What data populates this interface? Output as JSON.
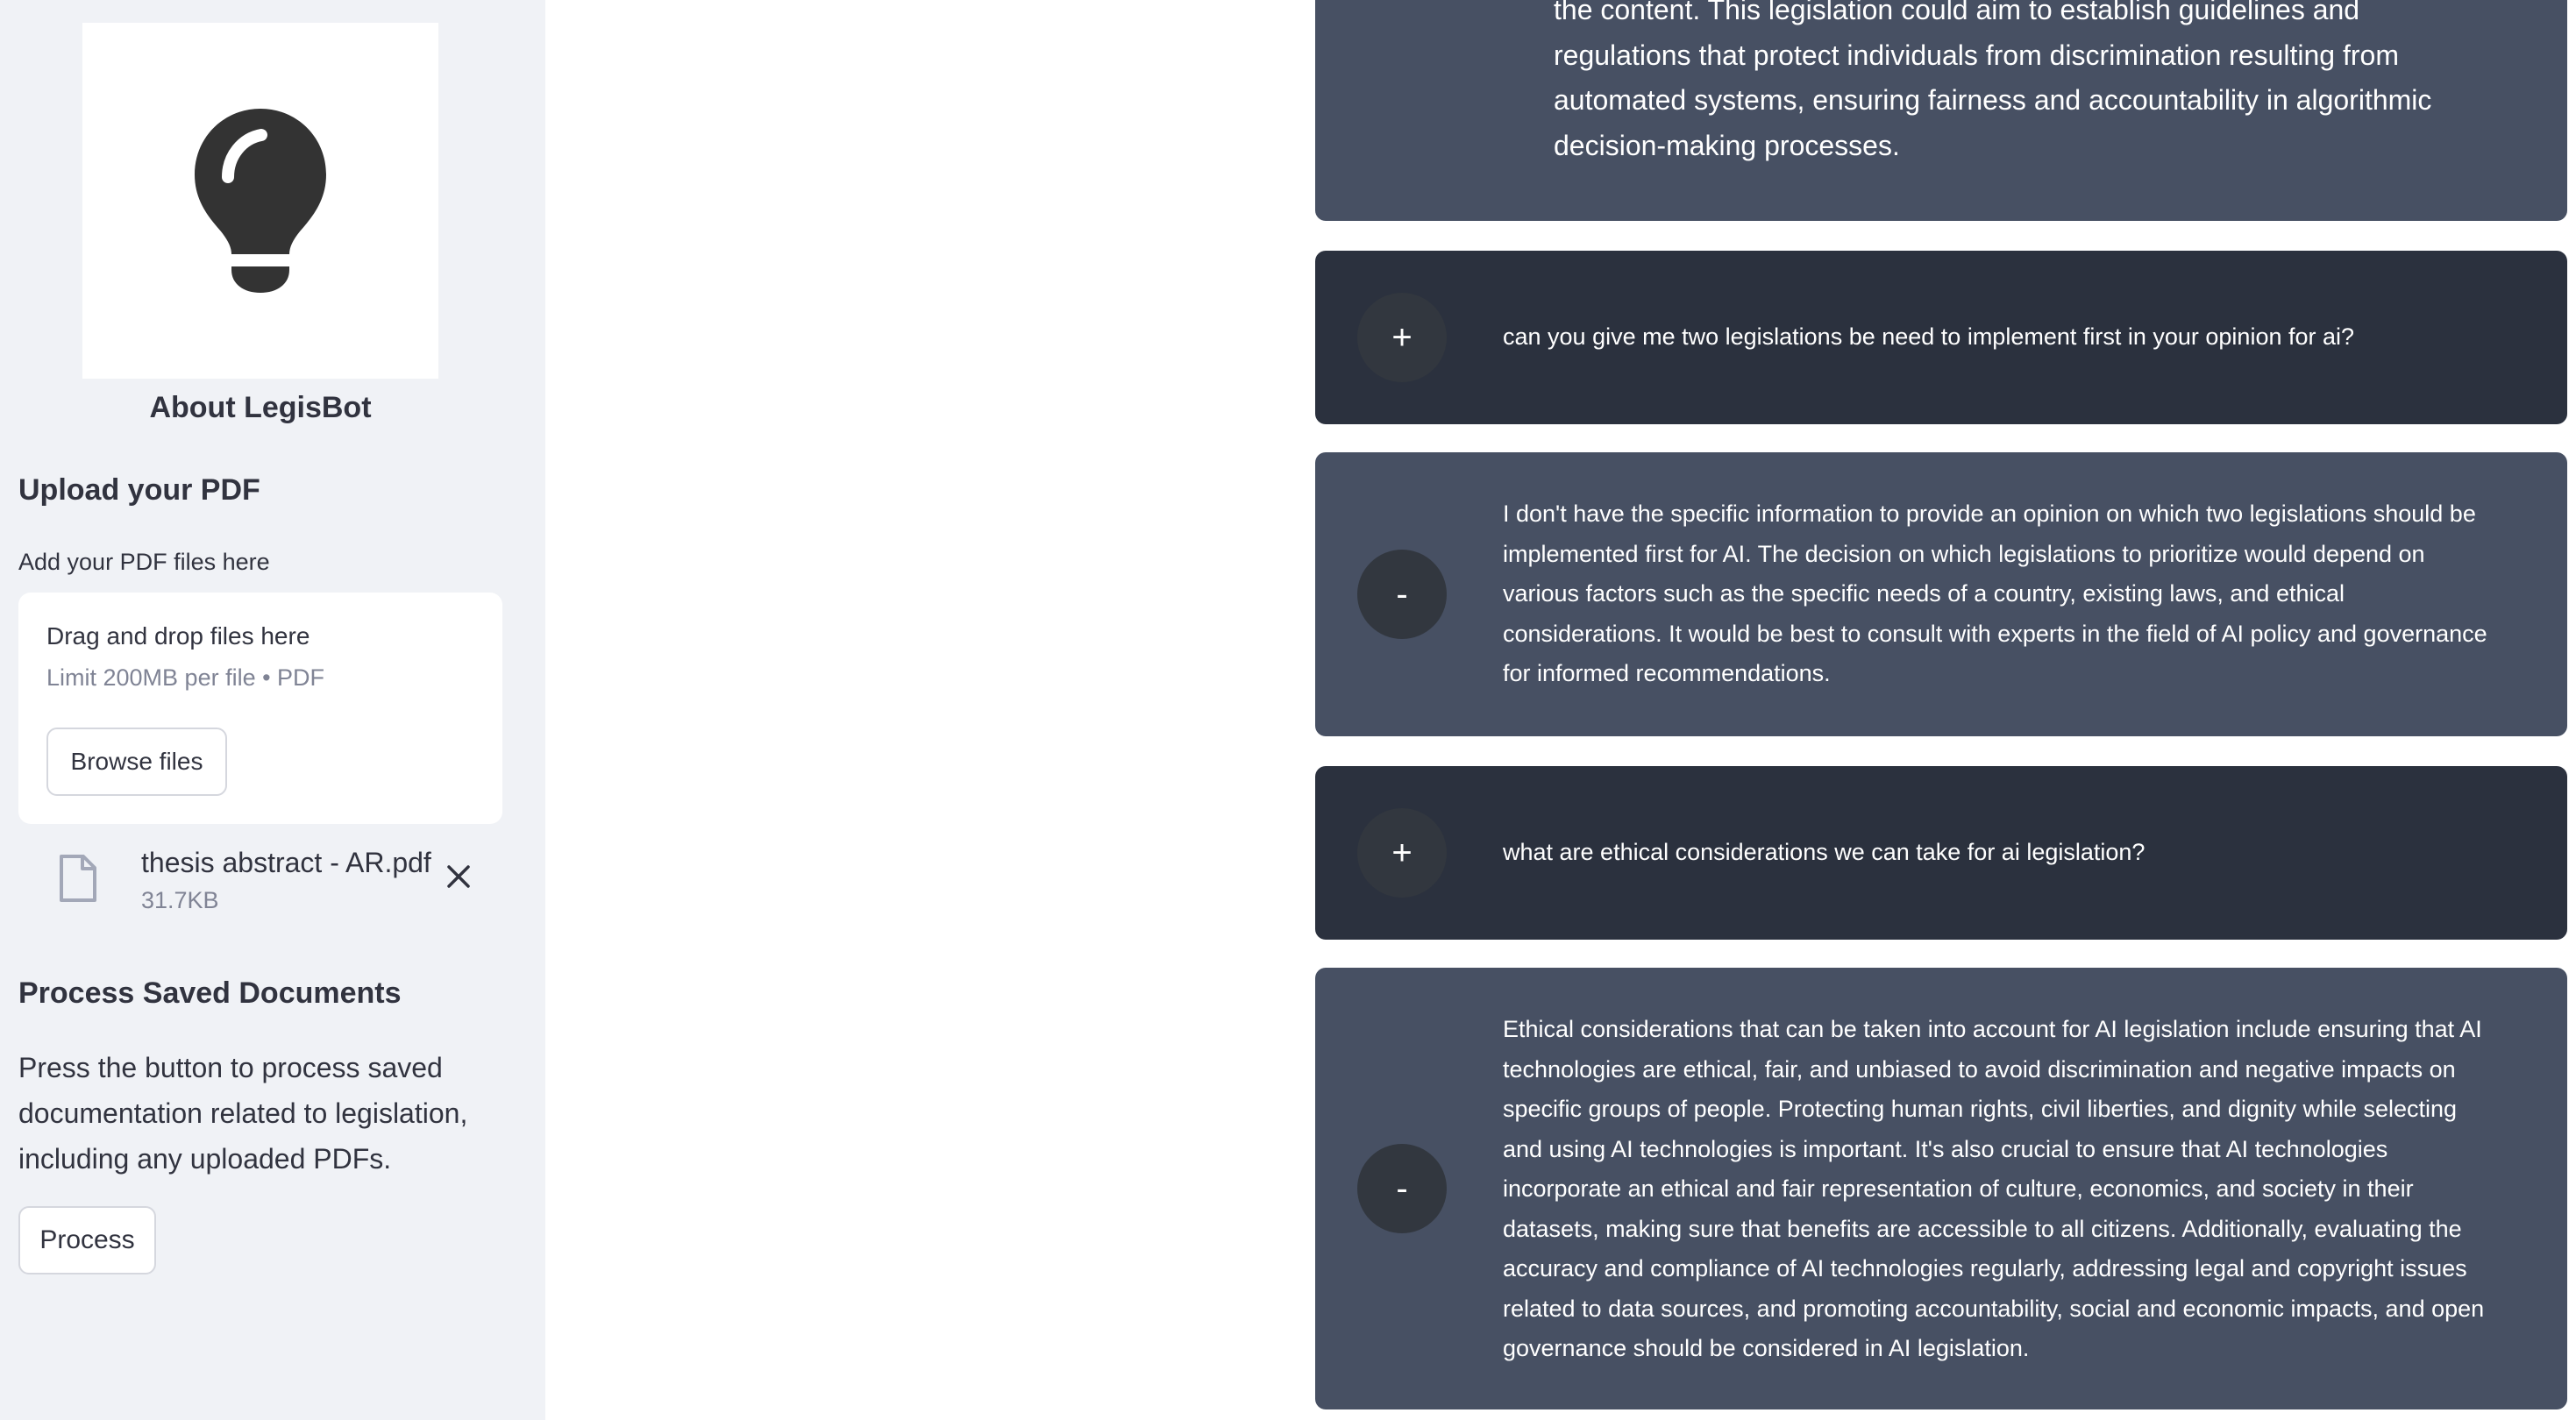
{
  "sidebar": {
    "logo_icon": "lightbulb-icon",
    "about_title": "About LegisBot",
    "upload_heading": "Upload your PDF",
    "upload_label": "Add your PDF files here",
    "dropzone": {
      "title": "Drag and drop files here",
      "limit": "Limit 200MB per file • PDF",
      "browse_label": "Browse files"
    },
    "uploaded_file": {
      "name": "thesis abstract - AR.pdf",
      "size": "31.7KB"
    },
    "process_heading": "Process Saved Documents",
    "process_description": "Press the button to process saved documentation related to legislation, including any uploaded PDFs.",
    "process_button": "Process"
  },
  "chat": {
    "messages": [
      {
        "role": "bot",
        "avatar": "",
        "text": "the content. This legislation could aim to establish guidelines and regulations that protect individuals from discrimination resulting from automated systems, ensuring fairness and accountability in algorithmic decision-making processes."
      },
      {
        "role": "user",
        "avatar": "+",
        "text": "can you give me two legislations be need to implement first in your opinion for ai?"
      },
      {
        "role": "bot",
        "avatar": "-",
        "text": "I don't have the specific information to provide an opinion on which two legislations should be implemented first for AI. The decision on which legislations to prioritize would depend on various factors such as the specific needs of a country, existing laws, and ethical considerations. It would be best to consult with experts in the field of AI policy and governance for informed recommendations."
      },
      {
        "role": "user",
        "avatar": "+",
        "text": "what are ethical considerations we can take for ai legislation?"
      },
      {
        "role": "bot",
        "avatar": "-",
        "text": "Ethical considerations that can be taken into account for AI legislation include ensuring that AI technologies are ethical, fair, and unbiased to avoid discrimination and negative impacts on specific groups of people. Protecting human rights, civil liberties, and dignity while selecting and using AI technologies is important. It's also crucial to ensure that AI technologies incorporate an ethical and fair representation of culture, economics, and society in their datasets, making sure that benefits are accessible to all citizens. Additionally, evaluating the accuracy and compliance of AI technologies regularly, addressing legal and copyright issues related to data sources, and promoting accountability, social and economic impacts, and open governance should be considered in AI legislation."
      }
    ]
  },
  "colors": {
    "sidebar_bg": "#f0f2f6",
    "user_message_bg": "#2b313e",
    "bot_message_bg": "#475063",
    "avatar_bg": "#32373f"
  }
}
